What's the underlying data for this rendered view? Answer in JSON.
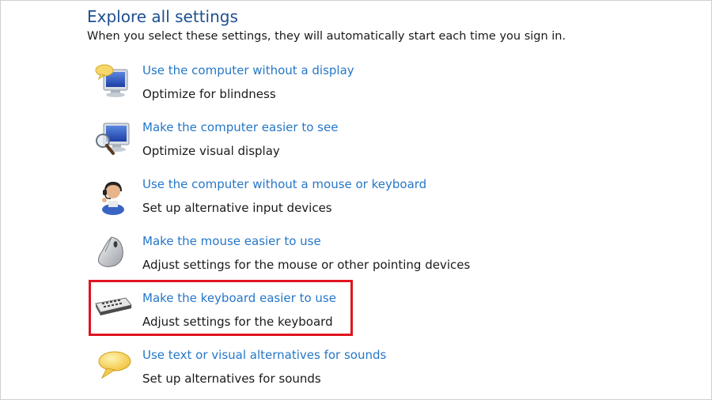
{
  "section": {
    "title": "Explore all settings",
    "subtitle": "When you select these settings, they will automatically start each time you sign in."
  },
  "items": [
    {
      "icon": "monitor-speech-bubble-icon",
      "link": "Use the computer without a display",
      "desc": "Optimize for blindness"
    },
    {
      "icon": "monitor-magnifier-icon",
      "link": "Make the computer easier to see",
      "desc": "Optimize visual display"
    },
    {
      "icon": "person-headset-icon",
      "link": "Use the computer without a mouse or keyboard",
      "desc": "Set up alternative input devices"
    },
    {
      "icon": "mouse-icon",
      "link": "Make the mouse easier to use",
      "desc": "Adjust settings for the mouse or other pointing devices"
    },
    {
      "icon": "keyboard-icon",
      "link": "Make the keyboard easier to use",
      "desc": "Adjust settings for the keyboard"
    },
    {
      "icon": "speech-bubble-icon",
      "link": "Use text or visual alternatives for sounds",
      "desc": "Set up alternatives for sounds"
    }
  ],
  "highlight": {
    "target": "Make the keyboard easier to use",
    "color": "#e0141e"
  },
  "colors": {
    "title": "#1e4f91",
    "link": "#2677c7",
    "text": "#1a1a1a"
  }
}
